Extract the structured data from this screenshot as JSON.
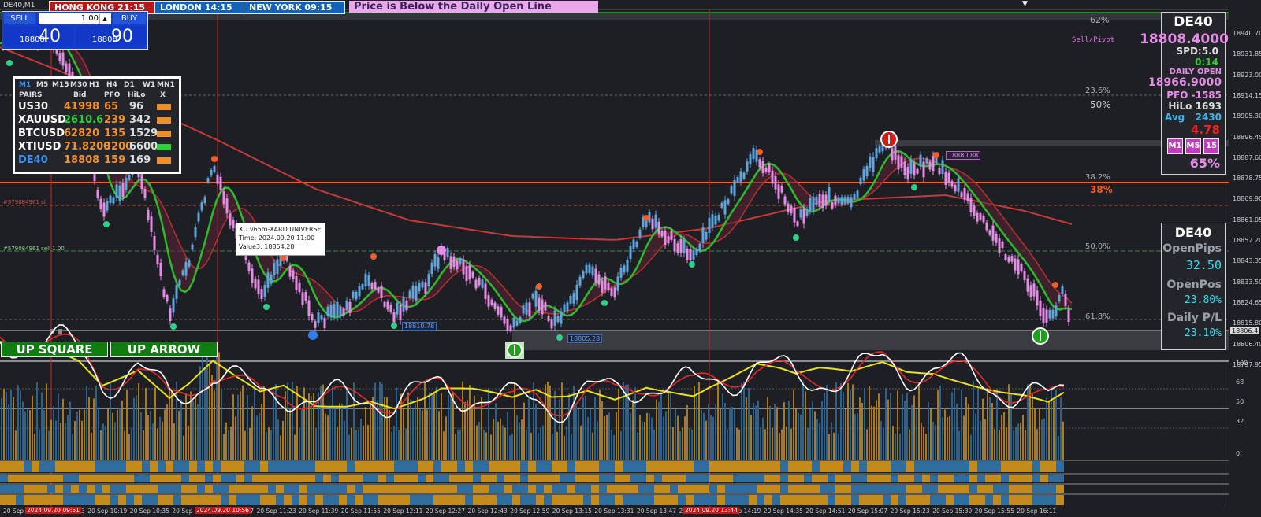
{
  "window": {
    "title": "DE40,M1"
  },
  "clocks": [
    {
      "id": "hk",
      "label": "HONG KONG 21:15"
    },
    {
      "id": "ld",
      "label": "LONDON  14:15"
    },
    {
      "id": "ny",
      "label": "NEW YORK  09:15"
    }
  ],
  "banner": "Price is Below the Daily Open Line",
  "trade_panel": {
    "sell_label": "SELL",
    "buy_label": "BUY",
    "lot": "1.00",
    "bid_small": "18808",
    "bid_big": "40",
    "ask_small": "18808",
    "ask_big": "90"
  },
  "mtf_panel": {
    "timeframes": [
      "M1",
      "M5",
      "M15",
      "M30",
      "H1",
      "H4",
      "D1",
      "W1",
      "MN1"
    ],
    "headers": [
      "PAIRS",
      "Bid",
      "PFO",
      "HiLo",
      "X"
    ],
    "rows": [
      {
        "pair": "US30",
        "bid": "41998",
        "pfo": "65",
        "hilo": "96",
        "pair_color": "#ffffff",
        "bid_color": "#f0902a",
        "bar_color": "#f0902a"
      },
      {
        "pair": "XAUUSD",
        "bid": "2610.6",
        "pfo": "239",
        "hilo": "342",
        "pair_color": "#ffffff",
        "bid_color": "#2fcf3a",
        "bar_color": "#f0902a"
      },
      {
        "pair": "BTCUSD",
        "bid": "62820",
        "pfo": "135",
        "hilo": "1529",
        "pair_color": "#ffffff",
        "bid_color": "#f0902a",
        "bar_color": "#f0902a"
      },
      {
        "pair": "XTIUSD",
        "bid": "71.8200",
        "pfo": "3200",
        "hilo": "6600",
        "pair_color": "#ffffff",
        "bid_color": "#f0902a",
        "bar_color": "#2fcf3a"
      },
      {
        "pair": "DE40",
        "bid": "18808",
        "pfo": "159",
        "hilo": "169",
        "pair_color": "#3b8ff0",
        "bid_color": "#f0902a",
        "bar_color": "#f0902a"
      }
    ]
  },
  "labels": {
    "up_square": "UP SQUARE",
    "up_arrow": "UP ARROW",
    "sell_pivot": "Sell/Pivot"
  },
  "info_panel": {
    "symbol": "DE40",
    "price": "18808.4000",
    "spread": "SPD:5.0",
    "timer": "0:14",
    "daily_open_label": "DAILY OPEN",
    "daily_open": "18966.9000",
    "pfo": "PFO -1585",
    "hilo": "HiLo 1693",
    "avg_label": "Avg",
    "avg": "2430",
    "value": "4.78",
    "tf_buttons": [
      "M1",
      "M5",
      "15"
    ],
    "percent": "65%"
  },
  "pnl_panel": {
    "symbol": "DE40",
    "open_pips_label": "OpenPips",
    "open_pips": "32.50",
    "open_pos_label": "OpenPos",
    "open_pos": "23.80%",
    "daily_pl_label": "Daily P/L",
    "daily_pl": "23.10%"
  },
  "fib_levels": [
    {
      "label": "62%",
      "color": "#3ec43e"
    },
    {
      "label": "23.6%",
      "color": "#a8a8a8"
    },
    {
      "label": "50%",
      "color": "#c9c9c9"
    },
    {
      "label": "38.2%",
      "color": "#a8a8a8"
    },
    {
      "label": "38%",
      "color": "#ff5a1f"
    },
    {
      "label": "50.0%",
      "color": "#a8a8a8"
    },
    {
      "label": "61.8%",
      "color": "#a8a8a8"
    }
  ],
  "order_lines": {
    "sl": "#579084961 sl",
    "sell": "#579084961 sell 1.00"
  },
  "tooltip": {
    "line1": "XU v65m-XARD UNIVERSE",
    "line2": "Time: 2024.09.20 11:00",
    "line3": "Value3: 18854.28"
  },
  "price_tags": [
    "18880.88",
    "18810.78",
    "18805.28"
  ],
  "price_axis": {
    "labels": [
      "18940.70",
      "18931.85",
      "18923.00",
      "18914.15",
      "18905.30",
      "18896.45",
      "18887.60",
      "18878.75",
      "18869.90",
      "18861.05",
      "18852.20",
      "18843.35",
      "18833.50",
      "18824.65",
      "18815.80",
      "18806.40",
      "18797.95"
    ],
    "current": "18806.4"
  },
  "osc_axis": [
    "100",
    "68",
    "50",
    "32",
    "0"
  ],
  "time_axis": {
    "labels": [
      "20 Sep 2024",
      "20 Sep 10:03",
      "20 Sep 10:19",
      "20 Sep 10:35",
      "20 Sep 10:51",
      "20 Sep 11:07",
      "20 Sep 11:23",
      "20 Sep 11:39",
      "20 Sep 11:55",
      "20 Sep 12:11",
      "20 Sep 12:27",
      "20 Sep 12:43",
      "20 Sep 12:59",
      "20 Sep 13:15",
      "20 Sep 13:31",
      "20 Sep 13:47",
      "20 Sep 14:03",
      "20 Sep 14:19",
      "20 Sep 14:35",
      "20 Sep 14:51",
      "20 Sep 15:07",
      "20 Sep 15:23",
      "20 Sep 15:39",
      "20 Sep 15:55",
      "20 Sep 16:11"
    ],
    "highlights": [
      "2024.09.20 09:51",
      "2024.09.20 10:56",
      "2024.09.20 13:44"
    ]
  },
  "colors": {
    "bull": "#5ea6dd",
    "bear": "#e58ce6",
    "ma_red": "#e32a2a",
    "ma_green": "#22d622",
    "osc_yellow": "#e8e219",
    "vol_gold": "#c28b1b",
    "vol_blue": "#2f6d9e",
    "fib_orange": "#ff5a1f"
  }
}
